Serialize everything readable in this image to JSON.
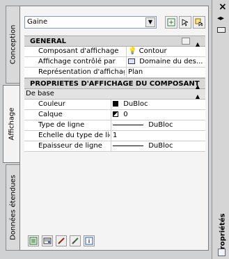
{
  "window": {
    "title": "Propriétés",
    "close_glyph": "×",
    "pin_glyph": "◂▸"
  },
  "tabs": [
    {
      "label": "Conception"
    },
    {
      "label": "Affichage"
    },
    {
      "label": "Données étendues"
    }
  ],
  "selector": {
    "value": "Gaine"
  },
  "sections": {
    "general": {
      "title": "GENERAL",
      "rows": [
        {
          "label": "Composant d'affichage",
          "value": "Contour"
        },
        {
          "label": "Affichage contrôlé par",
          "value": "Domaine du des..."
        },
        {
          "label": "Représentation d'affichage",
          "value": "Plan"
        }
      ]
    },
    "display_props": {
      "title": "PROPRIETES D'AFFICHAGE DU COMPOSANT"
    },
    "base": {
      "title": "De base",
      "rows": [
        {
          "label": "Couleur",
          "value": "DuBloc"
        },
        {
          "label": "Calque",
          "value": "0"
        },
        {
          "label": "Type de ligne",
          "value": "DuBloc"
        },
        {
          "label": "Echelle du type de ligne",
          "value": "1"
        },
        {
          "label": "Epaisseur de ligne",
          "value": "DuBloc"
        }
      ]
    }
  },
  "icons": [
    "dropdown-arrow-icon",
    "select-objects-icon",
    "quick-select-icon",
    "pickadd-icon",
    "display-manager-icon",
    "edit-style-icon",
    "brush-icon",
    "material-icon",
    "info-icon",
    "close-icon",
    "pin-icon",
    "options-icon",
    "properties-icon"
  ],
  "colors": {
    "panel_bg": "#cfd1d3",
    "content_bg": "#f4f4f4",
    "section_bg": "#d7d7d7",
    "grid_border": "#cfcfcf"
  }
}
